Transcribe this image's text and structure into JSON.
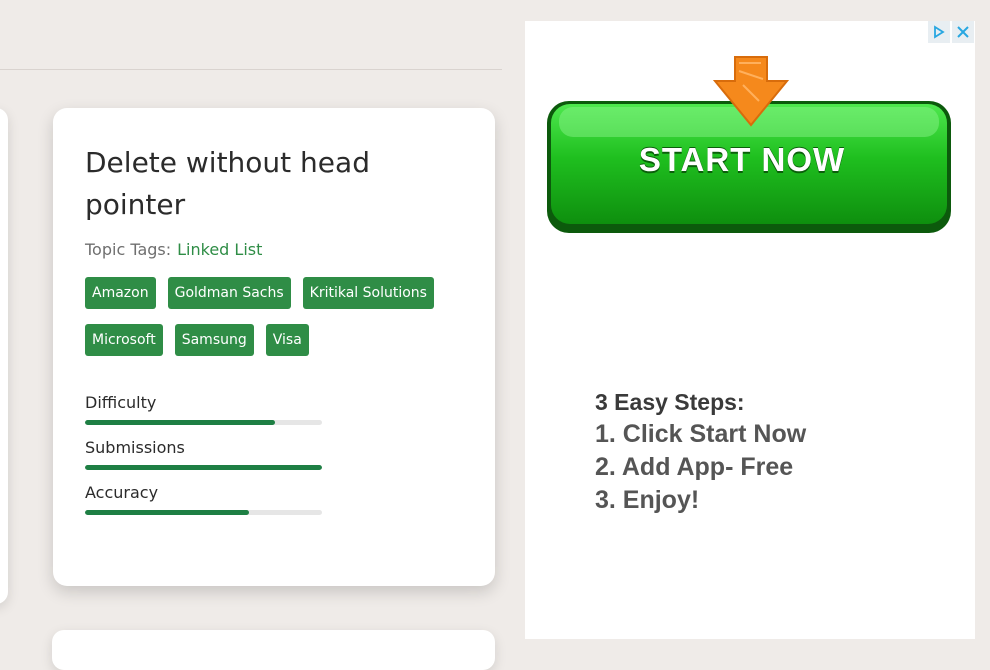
{
  "problem": {
    "title": "Delete without head pointer",
    "topic_tags_label": "Topic Tags:",
    "topic_tags": [
      "Linked List"
    ],
    "company_tags": [
      "Amazon",
      "Goldman Sachs",
      "Kritikal Solutions",
      "Microsoft",
      "Samsung",
      "Visa"
    ],
    "metrics": [
      {
        "label": "Difficulty",
        "fill_percent": 80
      },
      {
        "label": "Submissions",
        "fill_percent": 100
      },
      {
        "label": "Accuracy",
        "fill_percent": 69
      }
    ]
  },
  "ad": {
    "button_label": "START NOW",
    "steps_heading": "3 Easy Steps:",
    "steps": [
      "1. Click Start Now",
      "2. Add App- Free",
      "3. Enjoy!"
    ],
    "accent_green": "#2f8d46",
    "button_green": "#1db41d",
    "arrow_orange": "#f08a1c",
    "icons": [
      "ad-choices-icon",
      "close-icon"
    ]
  }
}
